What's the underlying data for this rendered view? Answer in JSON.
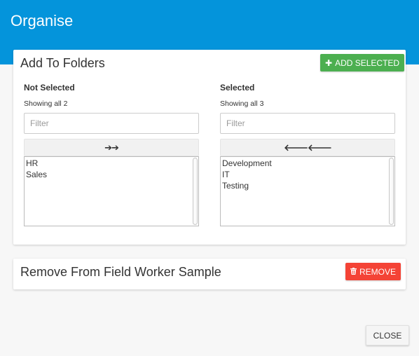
{
  "header": {
    "title": "Organise"
  },
  "add_card": {
    "title": "Add To Folders",
    "add_selected_label": "ADD SELECTED",
    "add_icon": "plus-icon",
    "not_selected": {
      "title": "Not Selected",
      "count_text": "Showing all 2",
      "filter_placeholder": "Filter",
      "move_glyph": "➔➔",
      "items": [
        "HR",
        "Sales"
      ]
    },
    "selected": {
      "title": "Selected",
      "count_text": "Showing all 3",
      "filter_placeholder": "Filter",
      "move_glyph": "🡐🡐",
      "items": [
        "Development",
        "IT",
        "Testing"
      ]
    }
  },
  "remove_card": {
    "title": "Remove From Field Worker Sample",
    "remove_label": "REMOVE",
    "remove_icon": "trash-icon"
  },
  "footer": {
    "close_label": "CLOSE"
  },
  "colors": {
    "header_bg": "#0494db",
    "add_button": "#4caf50",
    "remove_button": "#f44336"
  }
}
